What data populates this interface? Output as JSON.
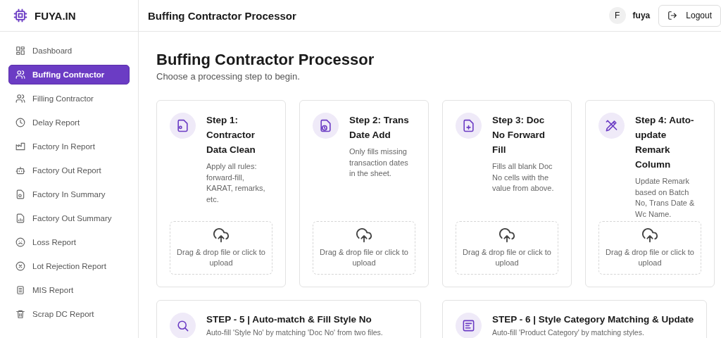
{
  "brand": {
    "name": "FUYA.IN"
  },
  "sidebar": {
    "items": [
      {
        "label": "Dashboard",
        "selected": false
      },
      {
        "label": "Buffing Contractor",
        "selected": true
      },
      {
        "label": "Filling Contractor",
        "selected": false
      },
      {
        "label": "Delay Report",
        "selected": false
      },
      {
        "label": "Factory In Report",
        "selected": false
      },
      {
        "label": "Factory Out Report",
        "selected": false
      },
      {
        "label": "Factory In Summary",
        "selected": false
      },
      {
        "label": "Factory Out Summary",
        "selected": false
      },
      {
        "label": "Loss Report",
        "selected": false
      },
      {
        "label": "Lot Rejection Report",
        "selected": false
      },
      {
        "label": "MIS Report",
        "selected": false
      },
      {
        "label": "Scrap DC Report",
        "selected": false
      }
    ]
  },
  "header": {
    "title": "Buffing Contractor Processor",
    "user": {
      "initial": "F",
      "name": "fuya"
    },
    "logout": "Logout"
  },
  "page": {
    "title": "Buffing Contractor Processor",
    "subtitle": "Choose a processing step to begin."
  },
  "steps": [
    {
      "title": "Step 1: Contractor Data Clean",
      "description": "Apply all rules: forward-fill, KARAT, remarks, etc.",
      "upload": "Drag & drop file or click to upload"
    },
    {
      "title": "Step 2: Trans Date Add",
      "description": "Only fills missing transaction dates in the sheet.",
      "upload": "Drag & drop file or click to upload"
    },
    {
      "title": "Step 3: Doc No Forward Fill",
      "description": "Fills all blank Doc No cells with the value from above.",
      "upload": "Drag & drop file or click to upload"
    },
    {
      "title": "Step 4: Auto-update Remark Column",
      "description": "Update Remark based on Batch No, Trans Date & Wc Name.",
      "upload": "Drag & drop file or click to upload"
    }
  ],
  "wide_steps": [
    {
      "title": "STEP - 5 | Auto-match & Fill Style No",
      "description": "Auto-fill 'Style No' by matching 'Doc No' from two files."
    },
    {
      "title": "STEP - 6 | Style Category Matching & Update",
      "description": "Auto-fill 'Product Category' by matching styles."
    }
  ]
}
